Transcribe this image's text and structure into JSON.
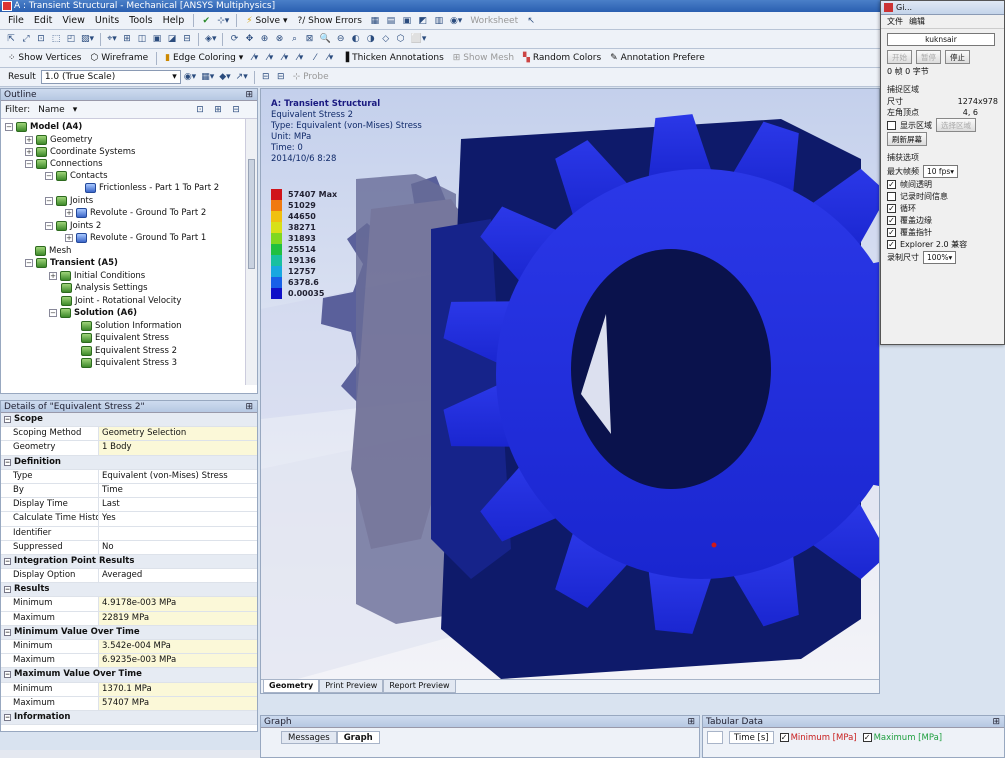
{
  "window": {
    "title": "A : Transient Structural - Mechanical [ANSYS Multiphysics]"
  },
  "menu": [
    "File",
    "Edit",
    "View",
    "Units",
    "Tools",
    "Help"
  ],
  "toolbar1": {
    "solve": "Solve",
    "show_errors": "?/ Show Errors",
    "worksheet": "Worksheet"
  },
  "toolbar3": {
    "show_vertices": "Show Vertices",
    "wireframe": "Wireframe",
    "edge_coloring": "Edge Coloring",
    "thicken_annotations": "Thicken Annotations",
    "show_mesh": "Show Mesh",
    "random_colors": "Random Colors",
    "annotation_prefs": "Annotation Prefere"
  },
  "toolbar4": {
    "result_label": "Result",
    "scale_value": "1.0 (True Scale)",
    "probe": "Probe"
  },
  "outline": {
    "title": "Outline",
    "filter_label": "Filter:",
    "filter_value": "Name",
    "nodes": [
      {
        "label": "Model (A4)",
        "bold": true
      },
      {
        "label": "Geometry"
      },
      {
        "label": "Coordinate Systems"
      },
      {
        "label": "Connections"
      },
      {
        "label": "Contacts"
      },
      {
        "label": "Frictionless - Part 1 To Part 2"
      },
      {
        "label": "Joints"
      },
      {
        "label": "Revolute - Ground To Part 2"
      },
      {
        "label": "Joints 2"
      },
      {
        "label": "Revolute - Ground To Part 1"
      },
      {
        "label": "Mesh"
      },
      {
        "label": "Transient (A5)",
        "bold": true
      },
      {
        "label": "Initial Conditions"
      },
      {
        "label": "Analysis Settings"
      },
      {
        "label": "Joint - Rotational Velocity"
      },
      {
        "label": "Solution (A6)",
        "bold": true
      },
      {
        "label": "Solution Information"
      },
      {
        "label": "Equivalent Stress"
      },
      {
        "label": "Equivalent Stress 2"
      },
      {
        "label": "Equivalent Stress 3"
      }
    ]
  },
  "details": {
    "title": "Details of \"Equivalent Stress 2\"",
    "rows": [
      {
        "section": "Scope"
      },
      {
        "k": "Scoping Method",
        "v": "Geometry Selection"
      },
      {
        "k": "Geometry",
        "v": "1 Body"
      },
      {
        "section": "Definition"
      },
      {
        "k": "Type",
        "v": "Equivalent (von-Mises) Stress",
        "plain": true
      },
      {
        "k": "By",
        "v": "Time",
        "plain": true
      },
      {
        "k": "Display Time",
        "v": "Last",
        "plain": true
      },
      {
        "k": "Calculate Time History",
        "v": "Yes",
        "plain": true
      },
      {
        "k": "Identifier",
        "v": "",
        "plain": true
      },
      {
        "k": "Suppressed",
        "v": "No",
        "plain": true
      },
      {
        "section": "Integration Point Results"
      },
      {
        "k": "Display Option",
        "v": "Averaged",
        "plain": true
      },
      {
        "section": "Results"
      },
      {
        "k": "Minimum",
        "v": "4.9178e-003 MPa"
      },
      {
        "k": "Maximum",
        "v": "22819 MPa"
      },
      {
        "section": "Minimum Value Over Time"
      },
      {
        "k": "Minimum",
        "v": "3.542e-004 MPa"
      },
      {
        "k": "Maximum",
        "v": "6.9235e-003 MPa"
      },
      {
        "section": "Maximum Value Over Time"
      },
      {
        "k": "Minimum",
        "v": "1370.1 MPa"
      },
      {
        "k": "Maximum",
        "v": "57407 MPa"
      },
      {
        "section": "Information"
      }
    ]
  },
  "viewport": {
    "info": [
      "A: Transient Structural",
      "Equivalent Stress 2",
      "Type: Equivalent (von-Mises) Stress",
      "Unit: MPa",
      "Time: 0",
      "2014/10/6 8:28"
    ],
    "legend": [
      {
        "label": "57407 Max",
        "color": "#d0141a"
      },
      {
        "label": "51029",
        "color": "#f07a10"
      },
      {
        "label": "44650",
        "color": "#f0c010"
      },
      {
        "label": "38271",
        "color": "#d8e018"
      },
      {
        "label": "31893",
        "color": "#80d820"
      },
      {
        "label": "25514",
        "color": "#20c040"
      },
      {
        "label": "19136",
        "color": "#18c0a0"
      },
      {
        "label": "12757",
        "color": "#18a8e0"
      },
      {
        "label": "6378.6",
        "color": "#1860e8"
      },
      {
        "label": "0.00035",
        "color": "#1010c8"
      }
    ],
    "tabs": [
      "Geometry",
      "Print Preview",
      "Report Preview"
    ]
  },
  "graph": {
    "title": "Graph",
    "tabs": [
      "Messages",
      "Graph"
    ]
  },
  "tabular": {
    "title": "Tabular Data",
    "col_time": "Time [s]",
    "col_min": "Minimum [MPa]",
    "col_max": "Maximum [MPa]"
  },
  "recorder": {
    "title": "Gi...",
    "menu": [
      "文件",
      "编辑"
    ],
    "field": "kuknsair",
    "btn_start": "开始",
    "btn_pause": "暂停",
    "btn_stop": "停止",
    "stats": "0 帧 0 字节",
    "group1": "捕捉区域",
    "size_label": "尺寸",
    "size_value": "1274x978",
    "corner_label": "左角顶点",
    "corner_value": "4, 6",
    "show_region": "显示区域",
    "select_region": "选择区域",
    "refresh": "刷新屏幕",
    "group2": "捕获选项",
    "fps_label": "最大帧频",
    "fps_value": "10 fps",
    "opts": [
      "帧间透明",
      "记录时间信息",
      "循环",
      "覆盖边缘",
      "覆盖指针",
      "Explorer 2.0 兼容"
    ],
    "opts_checked": [
      true,
      false,
      true,
      true,
      true,
      true
    ],
    "rec_size_label": "录制尺寸",
    "rec_size_value": "100%"
  },
  "colors": {
    "gear_front": "#1a2ee6",
    "gear_dark": "#0e1a6a",
    "gear_back": "#2a3488"
  }
}
